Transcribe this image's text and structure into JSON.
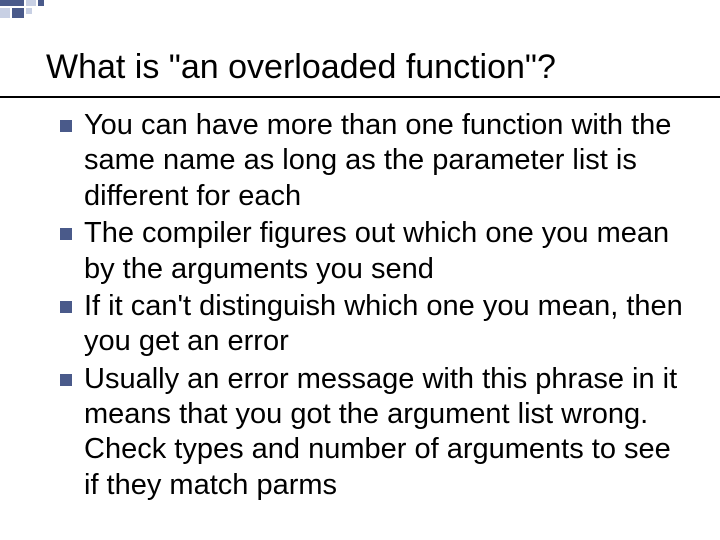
{
  "slide": {
    "title": "What is \"an overloaded function\"?",
    "bullets": [
      "You can have more than one function with the same name as long as the parameter list is different for each",
      "The compiler figures out which one you mean by the arguments you send",
      "If it can't distinguish which one you mean, then you get an error",
      "Usually an error message with this phrase in it means that you got the argument list wrong. Check types and number of arguments to see if they match parms"
    ]
  }
}
